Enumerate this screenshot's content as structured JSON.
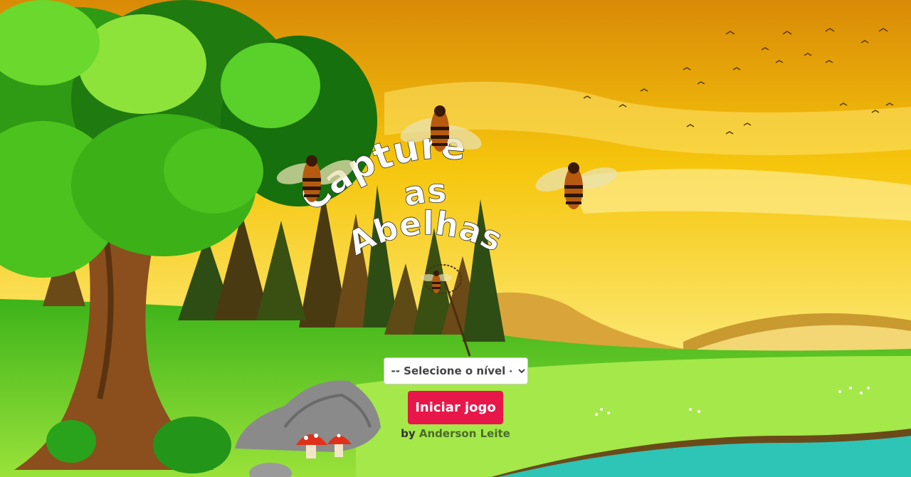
{
  "game": {
    "title_line1": "Capture",
    "title_line2": "as",
    "title_line3": "Abelhas"
  },
  "level_select": {
    "selected": "-- Selecione o nível --"
  },
  "start_button": {
    "label": "Iniciar jogo"
  },
  "credit": {
    "prefix": "by",
    "author": "Anderson Leite"
  },
  "colors": {
    "start_button": "#e8174a",
    "sky_top": "#e39b0a",
    "grass": "#7fd420"
  },
  "icons": [
    "bee-icon",
    "butterfly-net-icon",
    "tree-icon",
    "rock-icon",
    "mushroom-icon"
  ]
}
